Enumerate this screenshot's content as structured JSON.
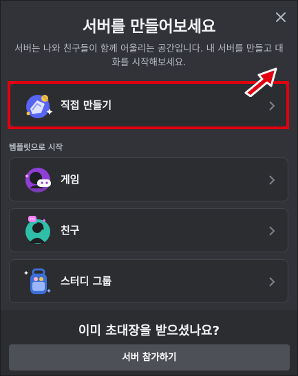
{
  "modal": {
    "title": "서버를 만들어보세요",
    "subtitle": "서버는 나와 친구들이 함께 어울리는 공간입니다. 내 서버를 만들고 대화를 시작해보세요.",
    "close_icon": "close-icon"
  },
  "create_option": {
    "label": "직접 만들기",
    "icon": "create-server-icon",
    "highlight_color": "#e1000f"
  },
  "templates": {
    "section_label": "템플릿으로 시작",
    "items": [
      {
        "label": "게임",
        "icon": "gaming-icon"
      },
      {
        "label": "친구",
        "icon": "friends-icon"
      },
      {
        "label": "스터디 그룹",
        "icon": "study-group-icon"
      }
    ]
  },
  "footer": {
    "title": "이미 초대장을 받으셨나요?",
    "join_button": "서버 참가하기"
  },
  "colors": {
    "background": "#313338",
    "card": "#2b2d31",
    "text": "#f2f3f5",
    "muted": "#b5bac1",
    "button": "#4e5058"
  }
}
